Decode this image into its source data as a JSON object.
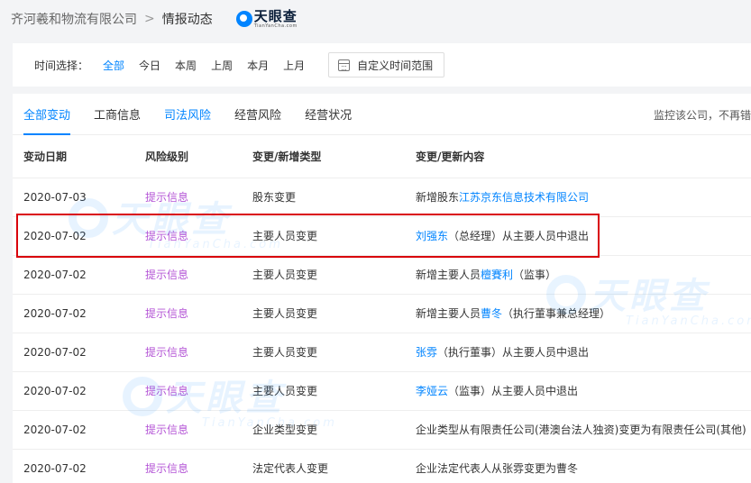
{
  "breadcrumb": {
    "company": "齐河羲和物流有限公司",
    "separator": ">",
    "current": "情报动态"
  },
  "logo": {
    "name": "天眼查",
    "sub": "TianYanCha.com",
    "color": "#0084ff"
  },
  "filter": {
    "label": "时间选择：",
    "options": [
      "全部",
      "今日",
      "本周",
      "上周",
      "本月",
      "上月"
    ],
    "selected": "全部",
    "custom_range_label": "自定义时间范围"
  },
  "tabs": {
    "items": [
      "全部变动",
      "工商信息",
      "司法风险",
      "经营风险",
      "经营状况"
    ],
    "active": "全部变动"
  },
  "monitor_tip": "监控该公司，不再错",
  "table": {
    "headers": [
      "变动日期",
      "风险级别",
      "变更/新增类型",
      "变更/更新内容"
    ],
    "rows": [
      {
        "date": "2020-07-03",
        "risk": "提示信息",
        "type": "股东变更",
        "content": [
          {
            "text": "新增股东",
            "link": false
          },
          {
            "text": "江苏京东信息技术有限公司",
            "link": true
          }
        ]
      },
      {
        "date": "2020-07-02",
        "risk": "提示信息",
        "type": "主要人员变更",
        "content": [
          {
            "text": "刘强东",
            "link": true
          },
          {
            "text": "（总经理）从主要人员中退出",
            "link": false
          }
        ]
      },
      {
        "date": "2020-07-02",
        "risk": "提示信息",
        "type": "主要人员变更",
        "content": [
          {
            "text": "新增主要人员",
            "link": false
          },
          {
            "text": "檀賽利",
            "link": true
          },
          {
            "text": "（监事）",
            "link": false
          }
        ]
      },
      {
        "date": "2020-07-02",
        "risk": "提示信息",
        "type": "主要人员变更",
        "content": [
          {
            "text": "新增主要人员",
            "link": false
          },
          {
            "text": "曹冬",
            "link": true
          },
          {
            "text": "（执行董事兼总经理）",
            "link": false
          }
        ]
      },
      {
        "date": "2020-07-02",
        "risk": "提示信息",
        "type": "主要人员变更",
        "content": [
          {
            "text": "张雰",
            "link": true
          },
          {
            "text": "（执行董事）从主要人员中退出",
            "link": false
          }
        ]
      },
      {
        "date": "2020-07-02",
        "risk": "提示信息",
        "type": "主要人员变更",
        "content": [
          {
            "text": "李娅云",
            "link": true
          },
          {
            "text": "（监事）从主要人员中退出",
            "link": false
          }
        ]
      },
      {
        "date": "2020-07-02",
        "risk": "提示信息",
        "type": "企业类型变更",
        "content": [
          {
            "text": "企业类型从有限责任公司(港澳台法人独资)变更为有限责任公司(其他)",
            "link": false
          }
        ]
      },
      {
        "date": "2020-07-02",
        "risk": "提示信息",
        "type": "法定代表人变更",
        "content": [
          {
            "text": "企业法定代表人从张雰变更为曹冬",
            "link": false
          }
        ]
      }
    ]
  },
  "colors": {
    "accent": "#0084ff",
    "risk": "#b455d6",
    "highlight_border": "#d9000b"
  }
}
